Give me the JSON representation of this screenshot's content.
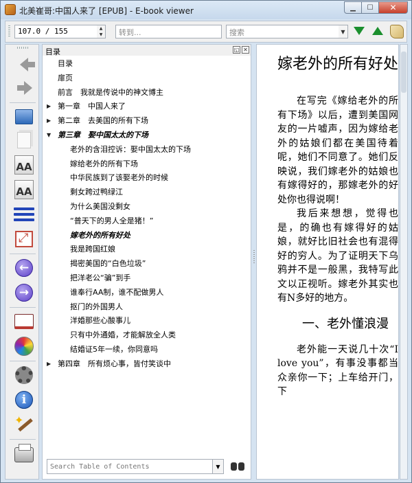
{
  "window": {
    "title": "北美崔哥:中国人来了 [EPUB] - E-book viewer",
    "minimize": "▁",
    "maximize": "☐",
    "close": "✕"
  },
  "toolbar": {
    "position_value": "107.0 / 155",
    "goto_placeholder": "转到...",
    "search_placeholder": "搜索",
    "spinner_up": "▲",
    "spinner_down": "▼",
    "dropdown": "▼"
  },
  "sidebar": {
    "font_large": "AA",
    "font_small": "AA",
    "back_glyph": "←",
    "forward_glyph": "→",
    "info_glyph": "i"
  },
  "toc": {
    "title": "目录",
    "float_btn": "◱",
    "close_btn": "✕",
    "search_placeholder": "Search Table of Contents",
    "items": [
      {
        "label": "目录",
        "level": 1,
        "arrow": "",
        "bold": false
      },
      {
        "label": "扉页",
        "level": 1,
        "arrow": "",
        "bold": false
      },
      {
        "label": "前言　我就是传说中的神文博主",
        "level": 1,
        "arrow": "",
        "bold": false
      },
      {
        "label": "第一章　中国人来了",
        "level": 1,
        "arrow": "▶",
        "bold": false
      },
      {
        "label": "第二章　去美国的所有下场",
        "level": 1,
        "arrow": "▶",
        "bold": false
      },
      {
        "label": "第三章　娶中国太太的下场",
        "level": 1,
        "arrow": "▼",
        "bold": true
      },
      {
        "label": "老外的含泪控诉：娶中国太太的下场",
        "level": 2,
        "arrow": "",
        "bold": false
      },
      {
        "label": "嫁给老外的所有下场",
        "level": 2,
        "arrow": "",
        "bold": false
      },
      {
        "label": "中华民族到了该娶老外的时候",
        "level": 2,
        "arrow": "",
        "bold": false
      },
      {
        "label": "剩女跨过鸭绿江",
        "level": 2,
        "arrow": "",
        "bold": false
      },
      {
        "label": "为什么美国没剩女",
        "level": 2,
        "arrow": "",
        "bold": false
      },
      {
        "label": "“普天下的男人全是猪！”",
        "level": 2,
        "arrow": "",
        "bold": false
      },
      {
        "label": "嫁老外的所有好处",
        "level": 2,
        "arrow": "",
        "bold": true
      },
      {
        "label": "我是跨国红娘",
        "level": 2,
        "arrow": "",
        "bold": false
      },
      {
        "label": "揭密美国的“白色垃圾”",
        "level": 2,
        "arrow": "",
        "bold": false
      },
      {
        "label": "把洋老公“骗”到手",
        "level": 2,
        "arrow": "",
        "bold": false
      },
      {
        "label": "谁奉行AA制，谁不配做男人",
        "level": 2,
        "arrow": "",
        "bold": false
      },
      {
        "label": "抠门的外国男人",
        "level": 2,
        "arrow": "",
        "bold": false
      },
      {
        "label": "洋婚那些心酸事儿",
        "level": 2,
        "arrow": "",
        "bold": false
      },
      {
        "label": "只有中外通婚，才能解放全人类",
        "level": 2,
        "arrow": "",
        "bold": false
      },
      {
        "label": "结婚证5年一续，你同意吗",
        "level": 2,
        "arrow": "",
        "bold": false
      },
      {
        "label": "第四章　所有烦心事，皆付笑谈中",
        "level": 1,
        "arrow": "▶",
        "bold": false
      }
    ]
  },
  "content": {
    "heading": "嫁老外的所有好处",
    "para1": "在写完《嫁给老外的所有下场》以后，遭到美国网友的一片嘘声，因为嫁给老外的姑娘们都在美国待着呢，她们不同意了。她们反映说，我们嫁老外的姑娘也有嫁得好的，那嫁老外的好处你也得说啊！",
    "para2": "我后来想想，觉得也是，的确也有嫁得好的姑娘，就好比旧社会也有混得好的穷人。为了证明天下乌鸦并不是一般黑，我特写此文以正视听。嫁老外其实也有N多好的地方。",
    "subheading": "一、老外懂浪漫",
    "para3": "老外能一天说几十次“I love you”，有事没事都当众亲你一下；上车给开门，下"
  }
}
